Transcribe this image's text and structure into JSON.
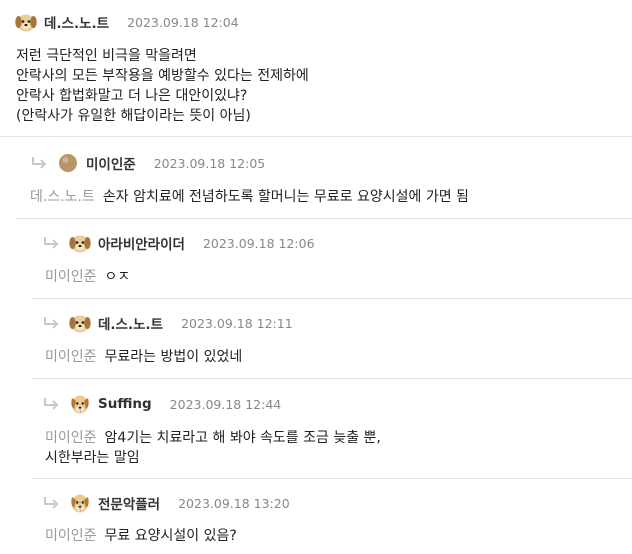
{
  "comments": [
    {
      "nick": "데.스.노.트",
      "date": "2023.09.18 12:04",
      "avatar": "puppy-icon",
      "lines": [
        "저런 극단적인 비극을 막을려면",
        "안락사의 모든 부작용을 예방할수 있다는 전제하에",
        "안락사 합법화말고 더 나은 대안이있냐?",
        "(안락사가 유일한 해답이라는 뜻이 아님)"
      ]
    },
    {
      "nick": "미이인준",
      "date": "2023.09.18 12:05",
      "avatar": "ball-avatar",
      "mention": "데.스.노.트",
      "lines": [
        "손자 암치료에 전념하도록 할머니는 무료로 요양시설에 가면 됨"
      ]
    },
    {
      "nick": "아라비안라이더",
      "date": "2023.09.18 12:06",
      "avatar": "puppy-icon",
      "mention": "미이인준",
      "lines": [
        "ㅇㅈ"
      ]
    },
    {
      "nick": "데.스.노.트",
      "date": "2023.09.18 12:11",
      "avatar": "puppy-icon",
      "mention": "미이인준",
      "lines": [
        "무료라는 방법이 있었네"
      ]
    },
    {
      "nick": "Suffing",
      "date": "2023.09.18 12:44",
      "avatar": "dog-icon",
      "mention": "미이인준",
      "lines": [
        "암4기는 치료라고 해 봐야 속도를 조금 늦출 뿐,",
        "시한부라는 말임"
      ]
    },
    {
      "nick": "전문악플러",
      "date": "2023.09.18 13:20",
      "avatar": "dog-icon",
      "mention": "미이인준",
      "lines": [
        "무료 요양시설이 있음?"
      ]
    }
  ]
}
